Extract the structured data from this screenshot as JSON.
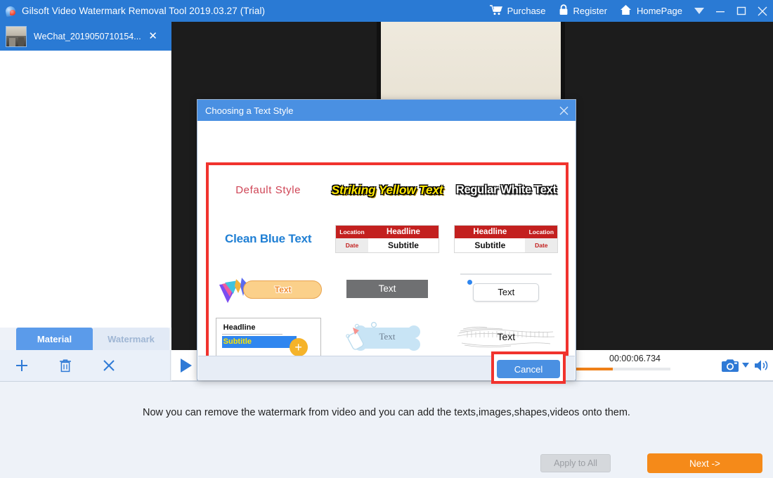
{
  "window": {
    "title": "Gilsoft Video Watermark Removal Tool 2019.03.27 (Trial)",
    "app_icon": "water-drop-icon",
    "toolbar": [
      {
        "id": "purchase",
        "label": "Purchase",
        "icon": "shopping-cart-icon"
      },
      {
        "id": "register",
        "label": "Register",
        "icon": "lock-icon"
      },
      {
        "id": "homepage",
        "label": "HomePage",
        "icon": "home-icon"
      }
    ],
    "controls": [
      {
        "id": "menu",
        "icon": "chevron-down-icon"
      },
      {
        "id": "minimize",
        "icon": "minimize-icon"
      },
      {
        "id": "maximize",
        "icon": "maximize-icon"
      },
      {
        "id": "close",
        "icon": "close-icon"
      }
    ]
  },
  "tab": {
    "label": "WeChat_2019050710154...",
    "close_icon": "close-icon",
    "thumbnail": "video-thumbnail"
  },
  "side_tabs": [
    {
      "id": "material",
      "label": "Material",
      "active": true
    },
    {
      "id": "watermark",
      "label": "Watermark",
      "active": false
    }
  ],
  "tool_buttons": [
    {
      "id": "add",
      "icon": "plus-icon",
      "label": "+"
    },
    {
      "id": "delete",
      "icon": "trash-icon",
      "label": ""
    },
    {
      "id": "clear",
      "icon": "close-icon",
      "label": ""
    }
  ],
  "player": {
    "play_icon": "play-icon",
    "timecode": "00:00:06.734",
    "progress_percent": 100,
    "snapshot_icon": "camera-icon",
    "snapshot_caret": "caret-down-icon",
    "volume_icon": "speaker-icon"
  },
  "footer": {
    "hint": "Now you can remove the watermark from video and you can add the texts,images,shapes,videos onto them.",
    "apply_label": "Apply to All",
    "apply_enabled": false,
    "next_label": "Next ->"
  },
  "dialog": {
    "title": "Choosing a Text Style",
    "close_icon": "close-icon",
    "cancel_label": "Cancel",
    "highlight_color": "#f1332e",
    "accent_color": "#4a90e2",
    "styles": [
      {
        "id": "default-style",
        "kind": "text",
        "label": "Default Style"
      },
      {
        "id": "striking-yellow-text",
        "kind": "text",
        "label": "Striking Yellow Text"
      },
      {
        "id": "regular-white-text",
        "kind": "text",
        "label": "Regular White Text"
      },
      {
        "id": "clean-blue-text",
        "kind": "text",
        "label": "Clean Blue Text"
      },
      {
        "id": "lower-third-left",
        "kind": "lower-third",
        "location": "Location",
        "headline": "Headline",
        "date": "Date",
        "subtitle": "Subtitle"
      },
      {
        "id": "lower-third-right",
        "kind": "lower-third",
        "location": "Location",
        "headline": "Headline",
        "date": "Date",
        "subtitle": "Subtitle"
      },
      {
        "id": "orange-pill-text",
        "kind": "badge",
        "label": "Text"
      },
      {
        "id": "gray-box-text",
        "kind": "badge",
        "label": "Text"
      },
      {
        "id": "white-card-text",
        "kind": "badge",
        "label": "Text"
      },
      {
        "id": "headline-subtitle-card",
        "kind": "card",
        "headline": "Headline",
        "subtitle": "Subtitle",
        "add_label": "+"
      },
      {
        "id": "baby-bottle-bone-text",
        "kind": "badge",
        "label": "Text"
      },
      {
        "id": "sketch-stroke-text",
        "kind": "badge",
        "label": "Text"
      }
    ]
  },
  "colors": {
    "title_bar": "#2a7ad4",
    "dialog_header": "#4a90e2",
    "highlight_red": "#f1332e",
    "next_orange": "#f58a19",
    "progress_orange": "#ef8018"
  }
}
